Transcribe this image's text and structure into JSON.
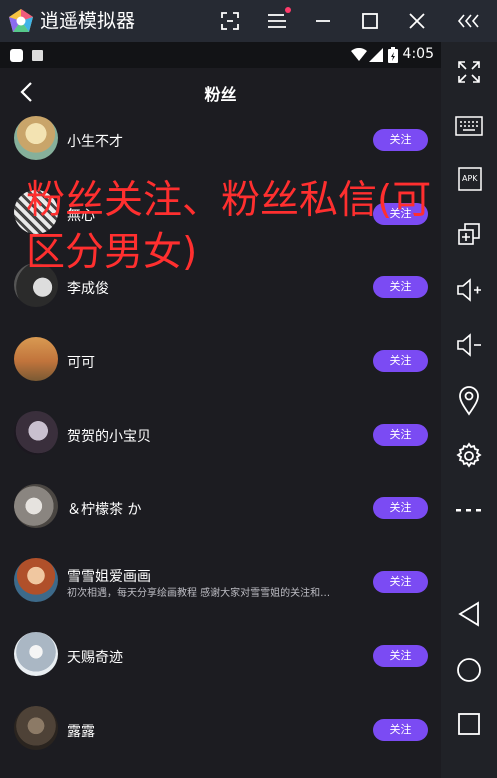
{
  "emulator": {
    "title": "逍遥模拟器",
    "colors": {
      "titlebar": "#262a33",
      "sidebar": "#202227",
      "accent": "#7b4bf3",
      "overlay_text": "#ff2f2f"
    },
    "title_buttons": [
      {
        "name": "screenshot-frame-icon"
      },
      {
        "name": "menu-icon"
      },
      {
        "name": "minimize-icon"
      },
      {
        "name": "maximize-icon"
      },
      {
        "name": "close-icon"
      },
      {
        "name": "collapse-sidebar-icon"
      }
    ],
    "sidebar_buttons": [
      {
        "name": "fullscreen-icon"
      },
      {
        "name": "keyboard-icon"
      },
      {
        "name": "apk-install-icon"
      },
      {
        "name": "multi-window-icon"
      },
      {
        "name": "volume-up-icon"
      },
      {
        "name": "volume-down-icon"
      },
      {
        "name": "location-icon"
      },
      {
        "name": "settings-gear-icon"
      },
      {
        "name": "more-icon"
      },
      {
        "name": "android-back-icon"
      },
      {
        "name": "android-home-icon"
      },
      {
        "name": "android-recents-icon"
      }
    ]
  },
  "status_bar": {
    "time": "4:05"
  },
  "page": {
    "title": "粉丝"
  },
  "fans": [
    {
      "name": "小生不才",
      "button": "关注",
      "description": ""
    },
    {
      "name": "無心",
      "button": "关注",
      "description": ""
    },
    {
      "name": "李成俊",
      "button": "关注",
      "description": ""
    },
    {
      "name": "可可",
      "button": "关注",
      "description": ""
    },
    {
      "name": "贺贺的小宝贝",
      "button": "关注",
      "description": ""
    },
    {
      "name": "＆柠檬茶 か",
      "button": "关注",
      "description": ""
    },
    {
      "name": "雪雪姐爱画画",
      "button": "关注",
      "description": "初次相遇，每天分享绘画教程 感谢大家对雪雪姐的关注和…"
    },
    {
      "name": "天赐奇迹",
      "button": "关注",
      "description": ""
    },
    {
      "name": "露露",
      "button": "关注",
      "description": ""
    }
  ],
  "overlay": {
    "line1": "粉丝关注、粉丝私信(可",
    "line2": "区分男女)"
  }
}
